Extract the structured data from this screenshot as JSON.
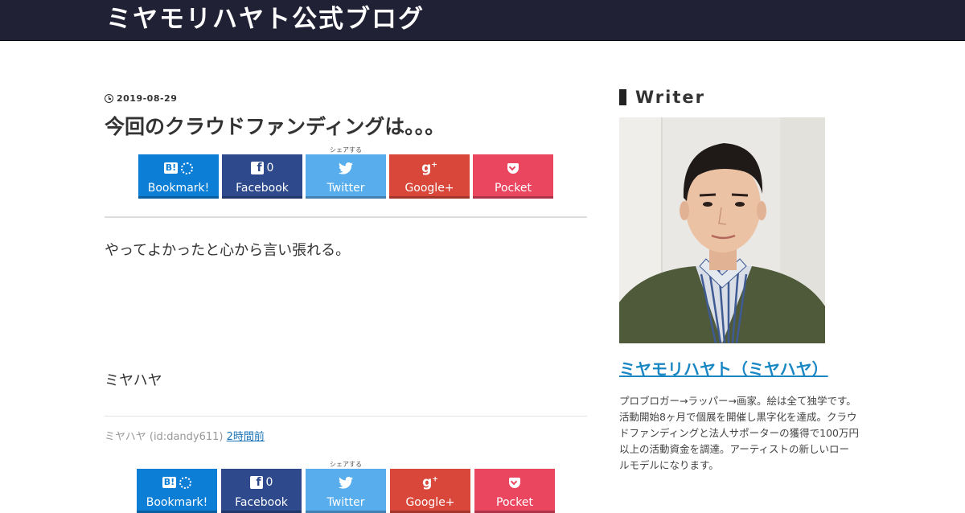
{
  "header": {
    "site_title": "ミヤモリハヤト公式ブログ"
  },
  "entry": {
    "date": "2019-08-29",
    "title": "今回のクラウドファンディングは。。。",
    "body_line1": "やってよかったと心から言い張れる。",
    "body_line2": "ミヤハヤ",
    "meta_author": "ミヤハヤ (id:dandy611)",
    "meta_time": "2時間前"
  },
  "share": {
    "label": "シェアする",
    "buttons": [
      {
        "name": "Bookmark!",
        "icon": "hatena-bookmark-icon",
        "color": "#0c7ed6"
      },
      {
        "name": "Facebook",
        "icon": "facebook-icon",
        "count": "0",
        "color": "#2e4a8d"
      },
      {
        "name": "Twitter",
        "icon": "twitter-icon",
        "color": "#58aded"
      },
      {
        "name": "Google+",
        "icon": "google-plus-icon",
        "color": "#d9473b"
      },
      {
        "name": "Pocket",
        "icon": "pocket-icon",
        "color": "#ea4660"
      }
    ]
  },
  "sidebar": {
    "widget_title": "Writer",
    "author_name": "ミヤモリハヤト（ミヤハヤ）",
    "author_description": "プロブロガー→ラッパー→画家。絵は全て独学です。活動開始8ヶ月で個展を開催し黒字化を達成。クラウドファンディングと法人サポーターの獲得で100万円以上の活動資金を調達。アーティストの新しいロールモデルになります。"
  }
}
